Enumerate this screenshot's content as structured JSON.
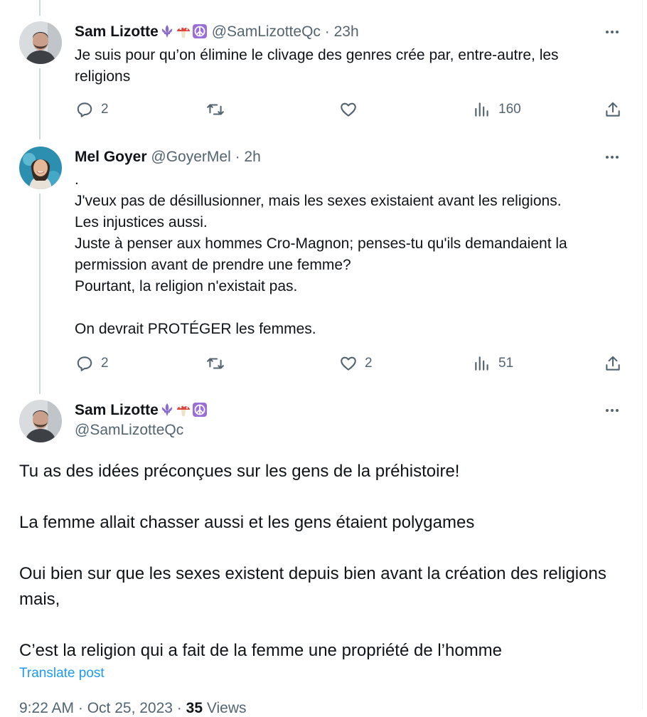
{
  "reply1": {
    "name": "Sam Lizotte",
    "handle": "@SamLizotteQc",
    "separator": "·",
    "time": "23h",
    "text": "Je suis pour qu’on élimine le clivage des genres crée par, entre-autre, les religions",
    "replies": "2",
    "retweets": "",
    "likes": "",
    "views": "160",
    "name_emojis": [
      "fleur-de-lis-icon",
      "mushroom-icon",
      "peace-symbol-icon"
    ]
  },
  "reply2": {
    "name": "Mel Goyer",
    "handle": "@GoyerMel",
    "separator": "·",
    "time": "2h",
    "text": ".\nJ'veux pas de désillusionner, mais les sexes existaient avant les religions.\nLes injustices aussi.\nJuste à penser aux hommes Cro-Magnon; penses-tu qu'ils demandaient la permission avant de prendre une femme?\nPourtant, la religion n'existait pas.\n\nOn devrait PROTÉGER les femmes.",
    "replies": "2",
    "retweets": "",
    "likes": "2",
    "views": "51"
  },
  "main_post": {
    "name": "Sam Lizotte",
    "handle": "@SamLizotteQc",
    "text": "Tu as des idées préconçues sur les gens de la préhistoire!\n\nLa femme allait chasser aussi et les gens étaient polygames\n\nOui bien sur que les sexes existent depuis bien avant la création des religions mais,\n\nC’est la religion qui a fait de la femme une propriété de l’homme",
    "translate_label": "Translate post",
    "timestamp": "9:22 AM · Oct 25, 2023 ·",
    "views_count": "35",
    "views_label": "Views"
  },
  "colors": {
    "text": "#0f1419",
    "secondary": "#536471",
    "link": "#1d9bf0",
    "thread_line": "#cfd9de",
    "peace_bg": "#9b6fd6"
  }
}
